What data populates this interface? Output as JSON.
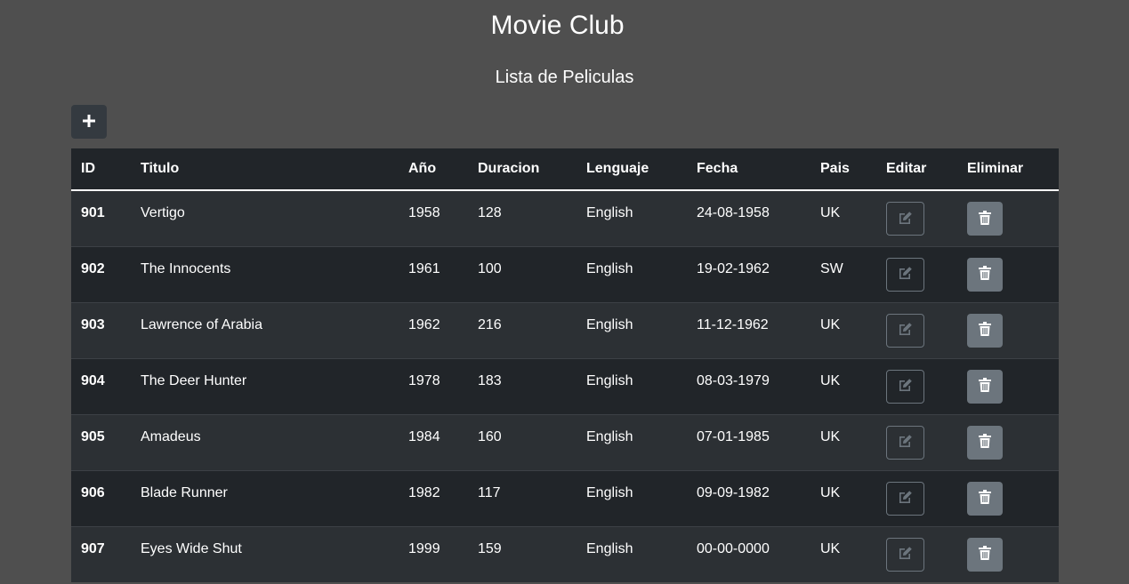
{
  "header": {
    "title": "Movie Club",
    "subtitle": "Lista de Peliculas"
  },
  "toolbar": {
    "add_icon": "plus-icon"
  },
  "table": {
    "columns": [
      "ID",
      "Titulo",
      "Año",
      "Duracion",
      "Lenguaje",
      "Fecha",
      "Pais",
      "Editar",
      "Eliminar"
    ],
    "rows": [
      {
        "id": "901",
        "title": "Vertigo",
        "year": "1958",
        "duration": "128",
        "language": "English",
        "date": "24-08-1958",
        "country": "UK"
      },
      {
        "id": "902",
        "title": "The Innocents",
        "year": "1961",
        "duration": "100",
        "language": "English",
        "date": "19-02-1962",
        "country": "SW"
      },
      {
        "id": "903",
        "title": "Lawrence of Arabia",
        "year": "1962",
        "duration": "216",
        "language": "English",
        "date": "11-12-1962",
        "country": "UK"
      },
      {
        "id": "904",
        "title": "The Deer Hunter",
        "year": "1978",
        "duration": "183",
        "language": "English",
        "date": "08-03-1979",
        "country": "UK"
      },
      {
        "id": "905",
        "title": "Amadeus",
        "year": "1984",
        "duration": "160",
        "language": "English",
        "date": "07-01-1985",
        "country": "UK"
      },
      {
        "id": "906",
        "title": "Blade Runner",
        "year": "1982",
        "duration": "117",
        "language": "English",
        "date": "09-09-1982",
        "country": "UK"
      },
      {
        "id": "907",
        "title": "Eyes Wide Shut",
        "year": "1999",
        "duration": "159",
        "language": "English",
        "date": "00-00-0000",
        "country": "UK"
      }
    ],
    "edit_icon": "edit-icon",
    "delete_icon": "trash-icon"
  },
  "colors": {
    "page_background": "#4f4f4f",
    "table_header": "#212529",
    "row_odd": "#2c3034",
    "row_even": "#212529",
    "delete_button": "#6c757d",
    "edit_border": "#6c757d"
  }
}
